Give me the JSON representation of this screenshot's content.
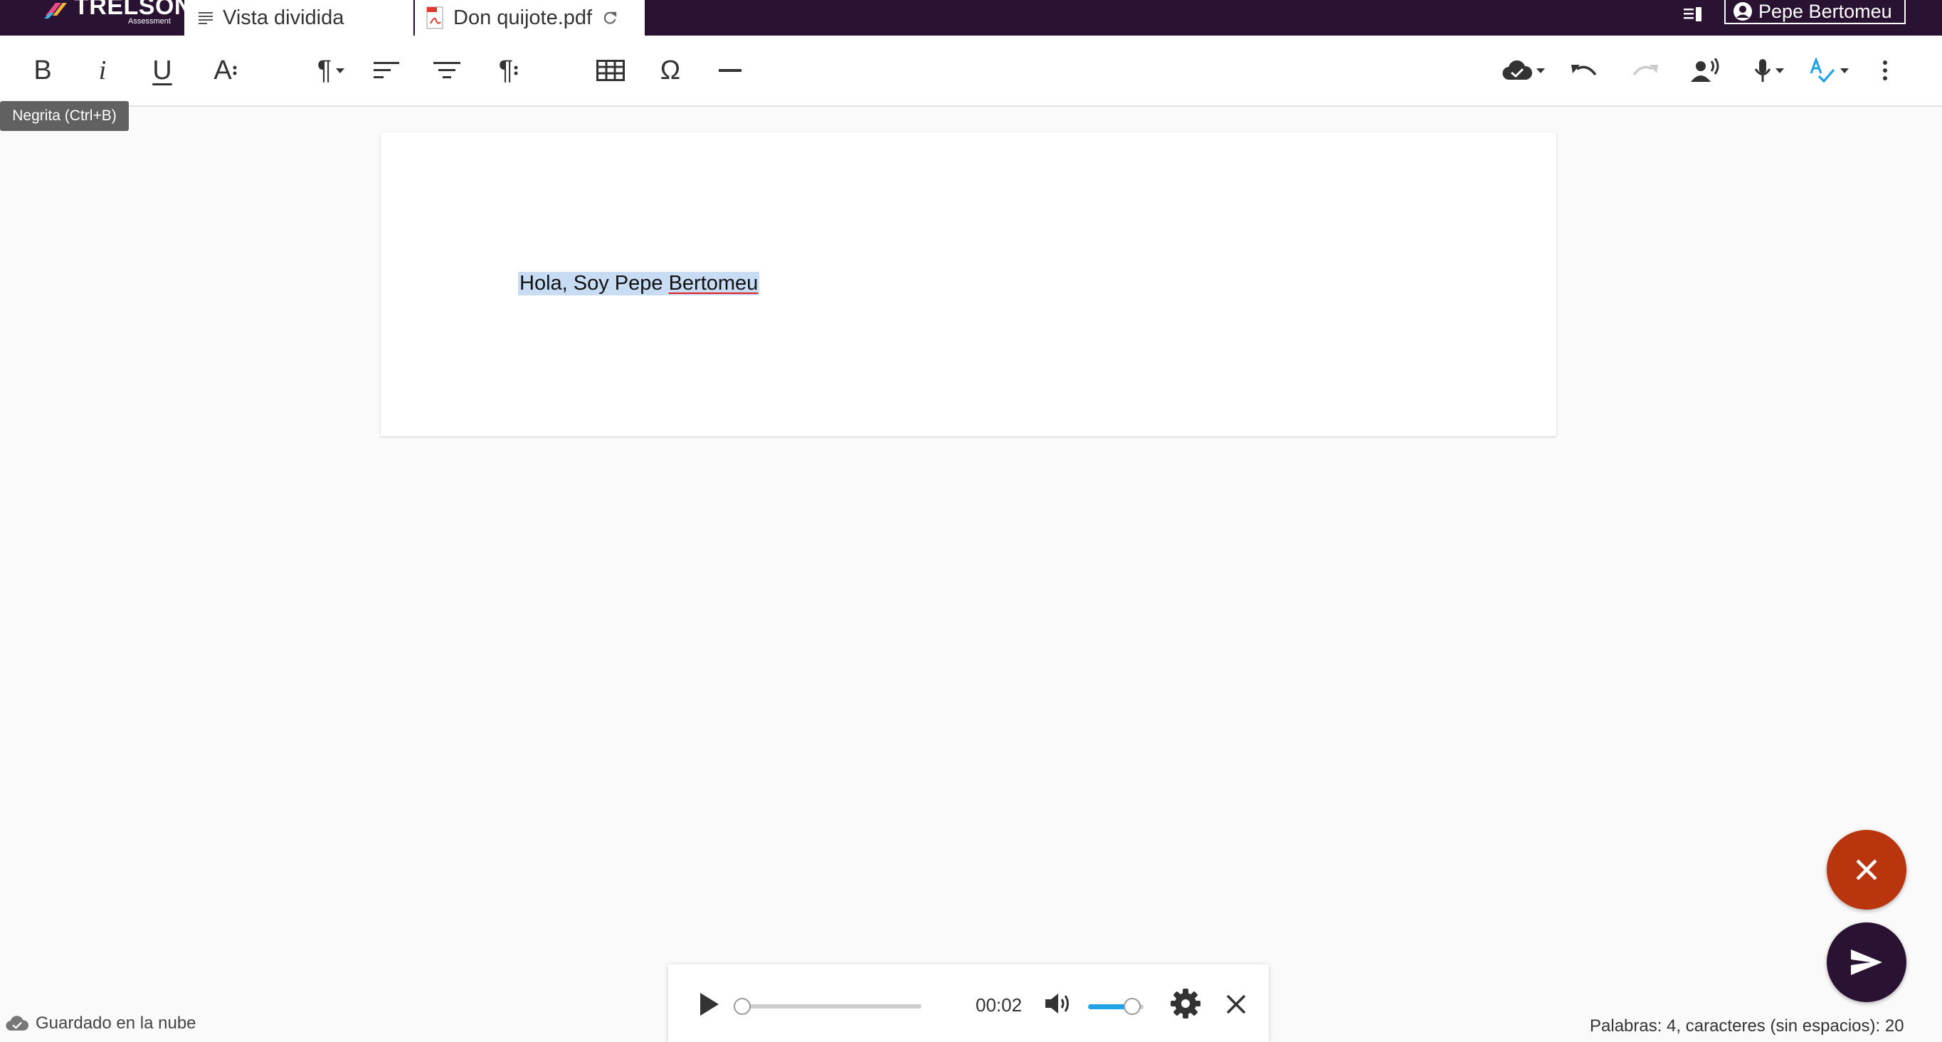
{
  "app": {
    "brand": "TRELSON",
    "brand_sub": "Assessment"
  },
  "tabs": [
    {
      "label": "Vista dividida",
      "icon": "lines-icon"
    },
    {
      "label": "Don quijote.pdf",
      "icon": "pdf-icon"
    }
  ],
  "user": {
    "name": "Pepe Bertomeu"
  },
  "toolbar": {
    "tooltip": "Negrita (Ctrl+B)",
    "bold": "B",
    "italic": "i",
    "underline": "U",
    "font_size": "A",
    "pilcrow": "¶",
    "omega": "Ω"
  },
  "document": {
    "text_part": "Hola, Soy Pepe ",
    "text_misspelled": "Bertomeu"
  },
  "player": {
    "time": "00:02",
    "progress": 0.0,
    "volume": 0.8
  },
  "footer": {
    "saved": "Guardado en la nube",
    "counts": "Palabras: 4, caracteres (sin espacios): 20"
  },
  "colors": {
    "topbar": "#2a1233",
    "accent_blue": "#1fa3e6",
    "close_fab": "#b8350e",
    "selection": "#c8ddf3"
  }
}
